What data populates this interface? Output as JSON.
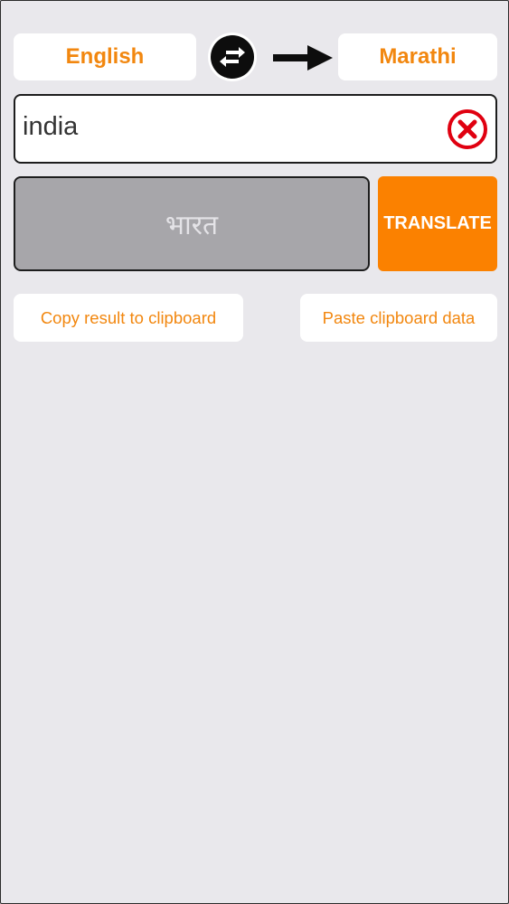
{
  "languages": {
    "source": "English",
    "target": "Marathi"
  },
  "icons": {
    "swap": "swap-arrows-icon",
    "direction": "right-arrow-icon",
    "clear": "clear-x-icon"
  },
  "input": {
    "value": "india"
  },
  "result": {
    "text": "भारत"
  },
  "buttons": {
    "translate": "TRANSLATE",
    "copy": "Copy result to clipboard",
    "paste": "Paste clipboard data"
  },
  "colors": {
    "accent": "#f2870f",
    "translate_bg": "#fb8100",
    "result_bg": "#a7a6aa",
    "clear_red": "#e00010",
    "page_bg": "#e9e8ec"
  }
}
